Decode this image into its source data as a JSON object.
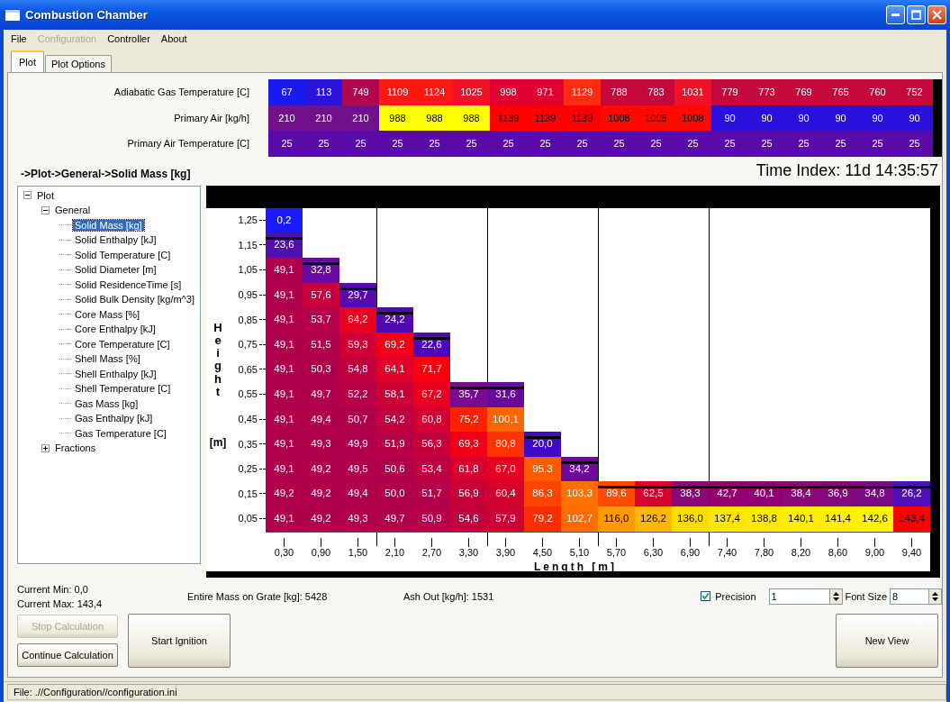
{
  "window": {
    "title": "Combustion Chamber"
  },
  "menu": [
    {
      "label": "File",
      "disabled": false
    },
    {
      "label": "Configuration",
      "disabled": true
    },
    {
      "label": "Controller",
      "disabled": false
    },
    {
      "label": "About",
      "disabled": false
    }
  ],
  "tabs": [
    {
      "label": "Plot",
      "selected": true
    },
    {
      "label": "Plot Options",
      "selected": false
    }
  ],
  "input_table": {
    "rows": [
      {
        "label": "Adiabatic Gas Temperature [C]",
        "cells": [
          {
            "value": "67",
            "color": "#1a1aee"
          },
          {
            "value": "113",
            "color": "#2814dc"
          },
          {
            "value": "749",
            "color": "#b0084c"
          },
          {
            "value": "1109",
            "color": "#ff1810"
          },
          {
            "value": "1124",
            "color": "#ff1810"
          },
          {
            "value": "1025",
            "color": "#f01028"
          },
          {
            "value": "998",
            "color": "#e00030"
          },
          {
            "value": "971",
            "color": "#e00030"
          },
          {
            "value": "1129",
            "color": "#ff2c10"
          },
          {
            "value": "788",
            "color": "#c4083c"
          },
          {
            "value": "783",
            "color": "#c4083c"
          },
          {
            "value": "1031",
            "color": "#f01028"
          },
          {
            "value": "779",
            "color": "#c4083c"
          },
          {
            "value": "773",
            "color": "#c4083c"
          },
          {
            "value": "769",
            "color": "#c4083c"
          },
          {
            "value": "765",
            "color": "#c4083c"
          },
          {
            "value": "760",
            "color": "#c4083c"
          },
          {
            "value": "752",
            "color": "#c4083c"
          }
        ]
      },
      {
        "label": "Primary Air [kg/h]",
        "cells": [
          {
            "value": "210",
            "color": "#70108c"
          },
          {
            "value": "210",
            "color": "#70108c"
          },
          {
            "value": "210",
            "color": "#70108c"
          },
          {
            "value": "988",
            "color": "#ffff00"
          },
          {
            "value": "988",
            "color": "#ffff00"
          },
          {
            "value": "988",
            "color": "#ffff00"
          },
          {
            "value": "1139",
            "color": "#ff0000"
          },
          {
            "value": "1139",
            "color": "#ff0000"
          },
          {
            "value": "1139",
            "color": "#ff0000"
          },
          {
            "value": "1008",
            "color": "#ff0800"
          },
          {
            "value": "1008",
            "color": "#ff0800"
          },
          {
            "value": "1008",
            "color": "#ff0800"
          },
          {
            "value": "90",
            "color": "#2a10dc"
          },
          {
            "value": "90",
            "color": "#2a10dc"
          },
          {
            "value": "90",
            "color": "#2a10dc"
          },
          {
            "value": "90",
            "color": "#2a10dc"
          },
          {
            "value": "90",
            "color": "#2a10dc"
          },
          {
            "value": "90",
            "color": "#2a10dc"
          }
        ]
      },
      {
        "label": "Primary Air Temperature [C]",
        "cells": [
          {
            "value": "25",
            "color": "#5a0aa8"
          },
          {
            "value": "25",
            "color": "#5a0aa8"
          },
          {
            "value": "25",
            "color": "#5a0aa8"
          },
          {
            "value": "25",
            "color": "#5a0aa8"
          },
          {
            "value": "25",
            "color": "#5a0aa8"
          },
          {
            "value": "25",
            "color": "#5a0aa8"
          },
          {
            "value": "25",
            "color": "#5a0aa8"
          },
          {
            "value": "25",
            "color": "#5a0aa8"
          },
          {
            "value": "25",
            "color": "#5a0aa8"
          },
          {
            "value": "25",
            "color": "#5a0aa8"
          },
          {
            "value": "25",
            "color": "#5a0aa8"
          },
          {
            "value": "25",
            "color": "#5a0aa8"
          },
          {
            "value": "25",
            "color": "#5a0aa8"
          },
          {
            "value": "25",
            "color": "#5a0aa8"
          },
          {
            "value": "25",
            "color": "#5a0aa8"
          },
          {
            "value": "25",
            "color": "#5a0aa8"
          },
          {
            "value": "25",
            "color": "#5a0aa8"
          },
          {
            "value": "25",
            "color": "#5a0aa8"
          }
        ]
      }
    ]
  },
  "breadcrumb": "->Plot->General->Solid Mass [kg]",
  "time_index": "Time Index: 11d 14:35:57",
  "tree": [
    {
      "label": "Plot",
      "expanded": true,
      "selected": false,
      "children": [
        {
          "label": "General",
          "expanded": true,
          "selected": false,
          "children": [
            {
              "label": "Solid Mass [kg]",
              "selected": true
            },
            {
              "label": "Solid Enthalpy [kJ]",
              "selected": false
            },
            {
              "label": "Solid Temperature [C]",
              "selected": false
            },
            {
              "label": "Solid Diameter [m]",
              "selected": false
            },
            {
              "label": "Solid ResidenceTime [s]",
              "selected": false
            },
            {
              "label": "Solid Bulk Density [kg/m^3]",
              "selected": false
            },
            {
              "label": "Core Mass [%]",
              "selected": false
            },
            {
              "label": "Core Enthalpy [kJ]",
              "selected": false
            },
            {
              "label": "Core Temperature [C]",
              "selected": false
            },
            {
              "label": "Shell Mass [%]",
              "selected": false
            },
            {
              "label": "Shell Enthalpy [kJ]",
              "selected": false
            },
            {
              "label": "Shell Temperature [C]",
              "selected": false
            },
            {
              "label": "Gas Mass [kg]",
              "selected": false
            },
            {
              "label": "Gas Enthalpy [kJ]",
              "selected": false
            },
            {
              "label": "Gas Temperature [C]",
              "selected": false
            }
          ]
        },
        {
          "label": "Fractions",
          "expanded": false,
          "selected": false
        }
      ]
    }
  ],
  "heatmap": {
    "y_title": "Height",
    "y_unit": "[m]",
    "x_title": "Length",
    "x_unit": "[m]",
    "y_labels": [
      "1,25",
      "1,15",
      "1,05",
      "0,95",
      "0,85",
      "0,75",
      "0,65",
      "0,55",
      "0,45",
      "0,35",
      "0,25",
      "0,15",
      "0,05"
    ],
    "columns": [
      {
        "label": "0,30",
        "divider": false,
        "cells": [
          {
            "value": "0,2",
            "color": "#1a1aff",
            "surface": false
          },
          {
            "value": "23,6",
            "color": "#5010b0",
            "surface": true
          },
          {
            "value": "49,1",
            "color": "#b0004c",
            "surface": false
          },
          {
            "value": "49,1",
            "color": "#b0004c",
            "surface": false
          },
          {
            "value": "49,1",
            "color": "#b0004c",
            "surface": false
          },
          {
            "value": "49,1",
            "color": "#b0004c",
            "surface": false
          },
          {
            "value": "49,1",
            "color": "#b0004c",
            "surface": false
          },
          {
            "value": "49,1",
            "color": "#b0004c",
            "surface": false
          },
          {
            "value": "49,1",
            "color": "#b0004c",
            "surface": false
          },
          {
            "value": "49,1",
            "color": "#b0004c",
            "surface": false
          },
          {
            "value": "49,1",
            "color": "#b0004c",
            "surface": false
          },
          {
            "value": "49,2",
            "color": "#b0004c",
            "surface": false
          },
          {
            "value": "49,1",
            "color": "#b0004c",
            "surface": false
          }
        ]
      },
      {
        "label": "0,90",
        "divider": false,
        "cells": [
          {
            "value": "32,8",
            "color": "#6a0aa0",
            "surface": true
          },
          {
            "value": "57,6",
            "color": "#c8003c",
            "surface": false
          },
          {
            "value": "53,7",
            "color": "#b8004a",
            "surface": false
          },
          {
            "value": "51,5",
            "color": "#b0004c",
            "surface": false
          },
          {
            "value": "50,3",
            "color": "#b0004c",
            "surface": false
          },
          {
            "value": "49,7",
            "color": "#b0004c",
            "surface": false
          },
          {
            "value": "49,4",
            "color": "#b0004c",
            "surface": false
          },
          {
            "value": "49,3",
            "color": "#b0004c",
            "surface": false
          },
          {
            "value": "49,2",
            "color": "#b0004c",
            "surface": false
          },
          {
            "value": "49,2",
            "color": "#b0004c",
            "surface": false
          },
          {
            "value": "49,2",
            "color": "#b0004c",
            "surface": false
          }
        ]
      },
      {
        "label": "1,50",
        "divider": true,
        "cells": [
          {
            "value": "29,7",
            "color": "#5a0aa8",
            "surface": true
          },
          {
            "value": "64,2",
            "color": "#e8001e",
            "surface": false
          },
          {
            "value": "59,3",
            "color": "#d00036",
            "surface": false
          },
          {
            "value": "54,8",
            "color": "#c0003e",
            "surface": false
          },
          {
            "value": "52,2",
            "color": "#b80046",
            "surface": false
          },
          {
            "value": "50,7",
            "color": "#b0004c",
            "surface": false
          },
          {
            "value": "49,9",
            "color": "#b0004c",
            "surface": false
          },
          {
            "value": "49,5",
            "color": "#b0004c",
            "surface": false
          },
          {
            "value": "49,4",
            "color": "#b0004c",
            "surface": false
          },
          {
            "value": "49,3",
            "color": "#b0004c",
            "surface": false
          }
        ]
      },
      {
        "label": "2,10",
        "divider": false,
        "cells": [
          {
            "value": "24,2",
            "color": "#5008b0",
            "surface": true
          },
          {
            "value": "69,2",
            "color": "#f00018",
            "surface": false
          },
          {
            "value": "64,1",
            "color": "#e0002a",
            "surface": false
          },
          {
            "value": "58,1",
            "color": "#cc0036",
            "surface": false
          },
          {
            "value": "54,2",
            "color": "#c0003e",
            "surface": false
          },
          {
            "value": "51,9",
            "color": "#b80046",
            "surface": false
          },
          {
            "value": "50,6",
            "color": "#b0004c",
            "surface": false
          },
          {
            "value": "50,0",
            "color": "#b0004c",
            "surface": false
          },
          {
            "value": "49,7",
            "color": "#b0004c",
            "surface": false
          }
        ]
      },
      {
        "label": "2,70",
        "divider": false,
        "cells": [
          {
            "value": "22,6",
            "color": "#4a08b8",
            "surface": true
          },
          {
            "value": "71,7",
            "color": "#f80010",
            "surface": false
          },
          {
            "value": "67,2",
            "color": "#e80020",
            "surface": false
          },
          {
            "value": "60,8",
            "color": "#d20032",
            "surface": false
          },
          {
            "value": "56,3",
            "color": "#c4003c",
            "surface": false
          },
          {
            "value": "53,4",
            "color": "#bc0044",
            "surface": false
          },
          {
            "value": "51,7",
            "color": "#b4004a",
            "surface": false
          },
          {
            "value": "50,9",
            "color": "#b4004a",
            "surface": false
          }
        ]
      },
      {
        "label": "3,30",
        "divider": true,
        "cells": [
          {
            "value": "35,7",
            "color": "#7a0a90",
            "surface": true
          },
          {
            "value": "75,2",
            "color": "#ff2000",
            "surface": false
          },
          {
            "value": "69,3",
            "color": "#f00018",
            "surface": false
          },
          {
            "value": "61,8",
            "color": "#d8002e",
            "surface": false
          },
          {
            "value": "56,9",
            "color": "#c8003a",
            "surface": false
          },
          {
            "value": "54,6",
            "color": "#c0003e",
            "surface": false
          }
        ]
      },
      {
        "label": "3,90",
        "divider": false,
        "cells": [
          {
            "value": "31,6",
            "color": "#6a0a9c",
            "surface": true
          },
          {
            "value": "100,1",
            "color": "#ff6400",
            "surface": false
          },
          {
            "value": "80,8",
            "color": "#ff3200",
            "surface": false
          },
          {
            "value": "67,0",
            "color": "#e80020",
            "surface": false
          },
          {
            "value": "60,4",
            "color": "#d4002e",
            "surface": false
          },
          {
            "value": "57,9",
            "color": "#cc0034",
            "surface": false
          }
        ]
      },
      {
        "label": "4,50",
        "divider": false,
        "cells": [
          {
            "value": "20,0",
            "color": "#4008c8",
            "surface": true
          },
          {
            "value": "95,3",
            "color": "#ff5a00",
            "surface": false
          },
          {
            "value": "86,3",
            "color": "#ff4400",
            "surface": false
          },
          {
            "value": "79,2",
            "color": "#ff2c00",
            "surface": false
          }
        ]
      },
      {
        "label": "5,10",
        "divider": true,
        "cells": [
          {
            "value": "34,2",
            "color": "#7008a0",
            "surface": true
          },
          {
            "value": "103,3",
            "color": "#ff7000",
            "surface": false
          },
          {
            "value": "102,7",
            "color": "#ff6c00",
            "surface": false
          }
        ]
      },
      {
        "label": "5,70",
        "divider": false,
        "cells": [
          {
            "value": "89,6",
            "color": "#ff4a00",
            "surface": true
          },
          {
            "value": "116,0",
            "color": "#ff9a00",
            "surface": false
          }
        ]
      },
      {
        "label": "6,30",
        "divider": false,
        "cells": [
          {
            "value": "62,5",
            "color": "#d8002c",
            "surface": true
          },
          {
            "value": "126,2",
            "color": "#ffb800",
            "surface": false
          }
        ]
      },
      {
        "label": "6,90",
        "divider": true,
        "cells": [
          {
            "value": "38,3",
            "color": "#8a0878",
            "surface": true
          },
          {
            "value": "136,0",
            "color": "#ffdc00",
            "surface": false
          }
        ]
      },
      {
        "label": "7,40",
        "divider": false,
        "cells": [
          {
            "value": "42,7",
            "color": "#940070",
            "surface": true
          },
          {
            "value": "137,4",
            "color": "#ffe600",
            "surface": false
          }
        ]
      },
      {
        "label": "7,80",
        "divider": false,
        "cells": [
          {
            "value": "40,1",
            "color": "#8e0074",
            "surface": true
          },
          {
            "value": "138,8",
            "color": "#ffea00",
            "surface": false
          }
        ]
      },
      {
        "label": "8,20",
        "divider": false,
        "cells": [
          {
            "value": "38,4",
            "color": "#8a0878",
            "surface": true
          },
          {
            "value": "140,1",
            "color": "#ffee00",
            "surface": false
          }
        ]
      },
      {
        "label": "8,60",
        "divider": false,
        "cells": [
          {
            "value": "36,9",
            "color": "#840880",
            "surface": true
          },
          {
            "value": "141,4",
            "color": "#fff000",
            "surface": false
          }
        ]
      },
      {
        "label": "9,00",
        "divider": false,
        "cells": [
          {
            "value": "34,8",
            "color": "#7c0888",
            "surface": true
          },
          {
            "value": "142,6",
            "color": "#fff400",
            "surface": false
          }
        ]
      },
      {
        "label": "9,40",
        "divider": false,
        "cells": [
          {
            "value": "26,2",
            "color": "#5010b8",
            "surface": true
          },
          {
            "value": "143,4",
            "color": "#ff0000",
            "surface": false
          }
        ]
      }
    ]
  },
  "current_min": "Current Min: 0,0",
  "current_max": "Current Max: 143,4",
  "mass_on_grate": "Entire Mass on Grate [kg]: 5428",
  "ash_out": "Ash Out [kg/h]: 1531",
  "precision": {
    "label": "Precision",
    "checked": true,
    "value": "1"
  },
  "font_size": {
    "label": "Font Size",
    "value": "8"
  },
  "buttons": [
    {
      "label": "Stop Calculation",
      "disabled": true
    },
    {
      "label": "Continue Calculation",
      "disabled": false
    },
    {
      "label": "Start Ignition",
      "disabled": false
    },
    {
      "label": "New View",
      "disabled": false
    }
  ],
  "status_bar": "File: .//Configuration//configuration.ini"
}
